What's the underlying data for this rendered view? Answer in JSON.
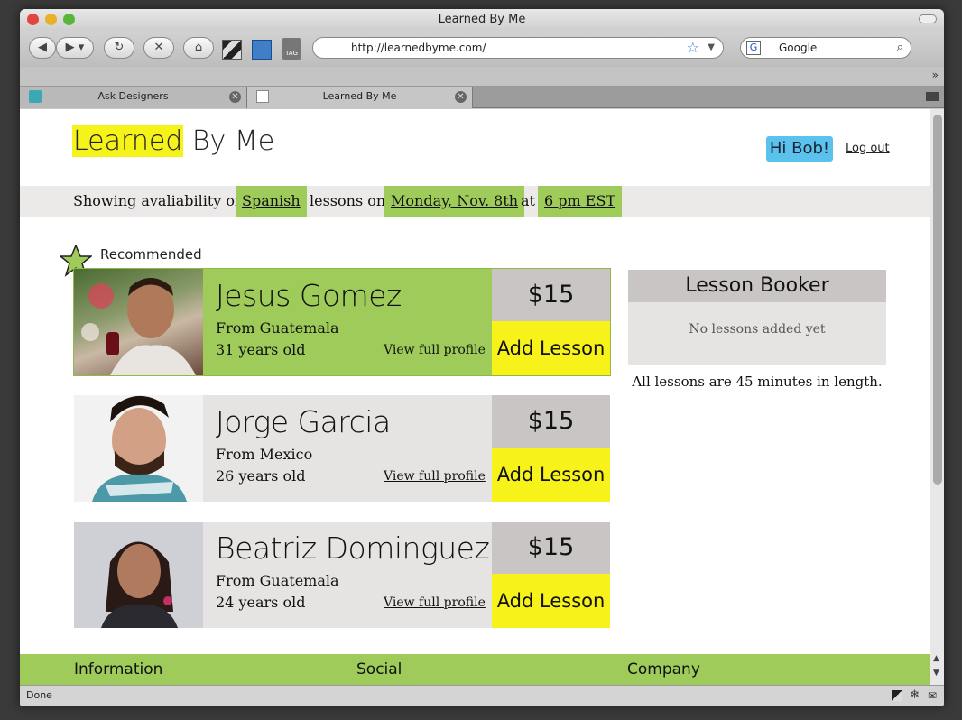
{
  "browser": {
    "window_title": "Learned By Me",
    "url": "http://learnedbyme.com/",
    "search_placeholder": "Google",
    "tabs": [
      {
        "label": "Ask Designers"
      },
      {
        "label": "Learned By Me"
      }
    ],
    "status": "Done",
    "tag_label": "TAG"
  },
  "header": {
    "logo_highlight": "Learned",
    "logo_rest": " By Me",
    "greeting": "Hi Bob!",
    "logout": "Log out"
  },
  "filter": {
    "prefix": "Showing avaliability of",
    "language": "Spanish",
    "middle": "lessons on",
    "date": "Monday, Nov. 8th",
    "at": "at",
    "time": "6 pm EST"
  },
  "recommended_label": "Recommended",
  "teachers": [
    {
      "name": "Jesus Gomez",
      "from": "From Guatemala",
      "age": "31 years old",
      "profile_link": "View full profile",
      "price": "$15",
      "add_label": "Add Lesson"
    },
    {
      "name": "Jorge Garcia",
      "from": "From Mexico",
      "age": "26 years old",
      "profile_link": "View full profile",
      "price": "$15",
      "add_label": "Add Lesson"
    },
    {
      "name": "Beatriz Dominguez",
      "from": "From Guatemala",
      "age": "24 years old",
      "profile_link": "View full profile",
      "price": "$15",
      "add_label": "Add Lesson"
    }
  ],
  "booker": {
    "title": "Lesson Booker",
    "empty": "No lessons added yet",
    "note": "All lessons are 45 minutes in length."
  },
  "footer": {
    "columns": [
      "Information",
      "Social",
      "Company"
    ]
  },
  "colors": {
    "green": "#9fcb5a",
    "yellow": "#f7f21a",
    "blue": "#5bc2ee",
    "grey": "#c9c5c5"
  }
}
